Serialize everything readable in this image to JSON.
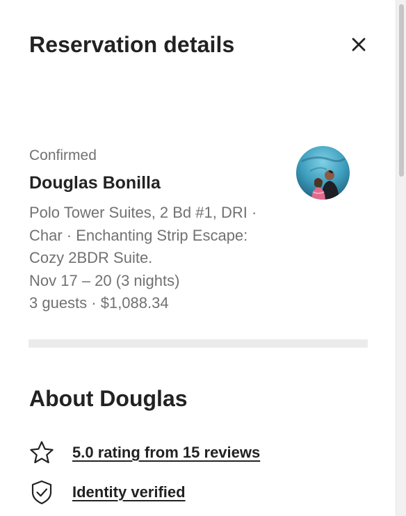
{
  "header": {
    "title": "Reservation details",
    "close_icon": "close-icon"
  },
  "reservation": {
    "status": "Confirmed",
    "guest_name": "Douglas Bonilla",
    "listing_lines": [
      "Polo Tower Suites, 2 Bd #1, DRI ·",
      "Char · Enchanting Strip Escape:",
      "Cozy 2BDR Suite."
    ],
    "dates": "Nov 17 – 20 (3 nights)",
    "guests_total": "3 guests · $1,088.34",
    "avatar": "guest-avatar-photo"
  },
  "about": {
    "title": "About Douglas",
    "rating_text": "5.0 rating from 15 reviews",
    "rating_icon": "star-icon",
    "identity_text": "Identity verified",
    "identity_icon": "shield-check-icon"
  },
  "colors": {
    "primary_text": "#222222",
    "secondary_text": "#717171",
    "divider": "#ebebeb",
    "background": "#ffffff"
  }
}
